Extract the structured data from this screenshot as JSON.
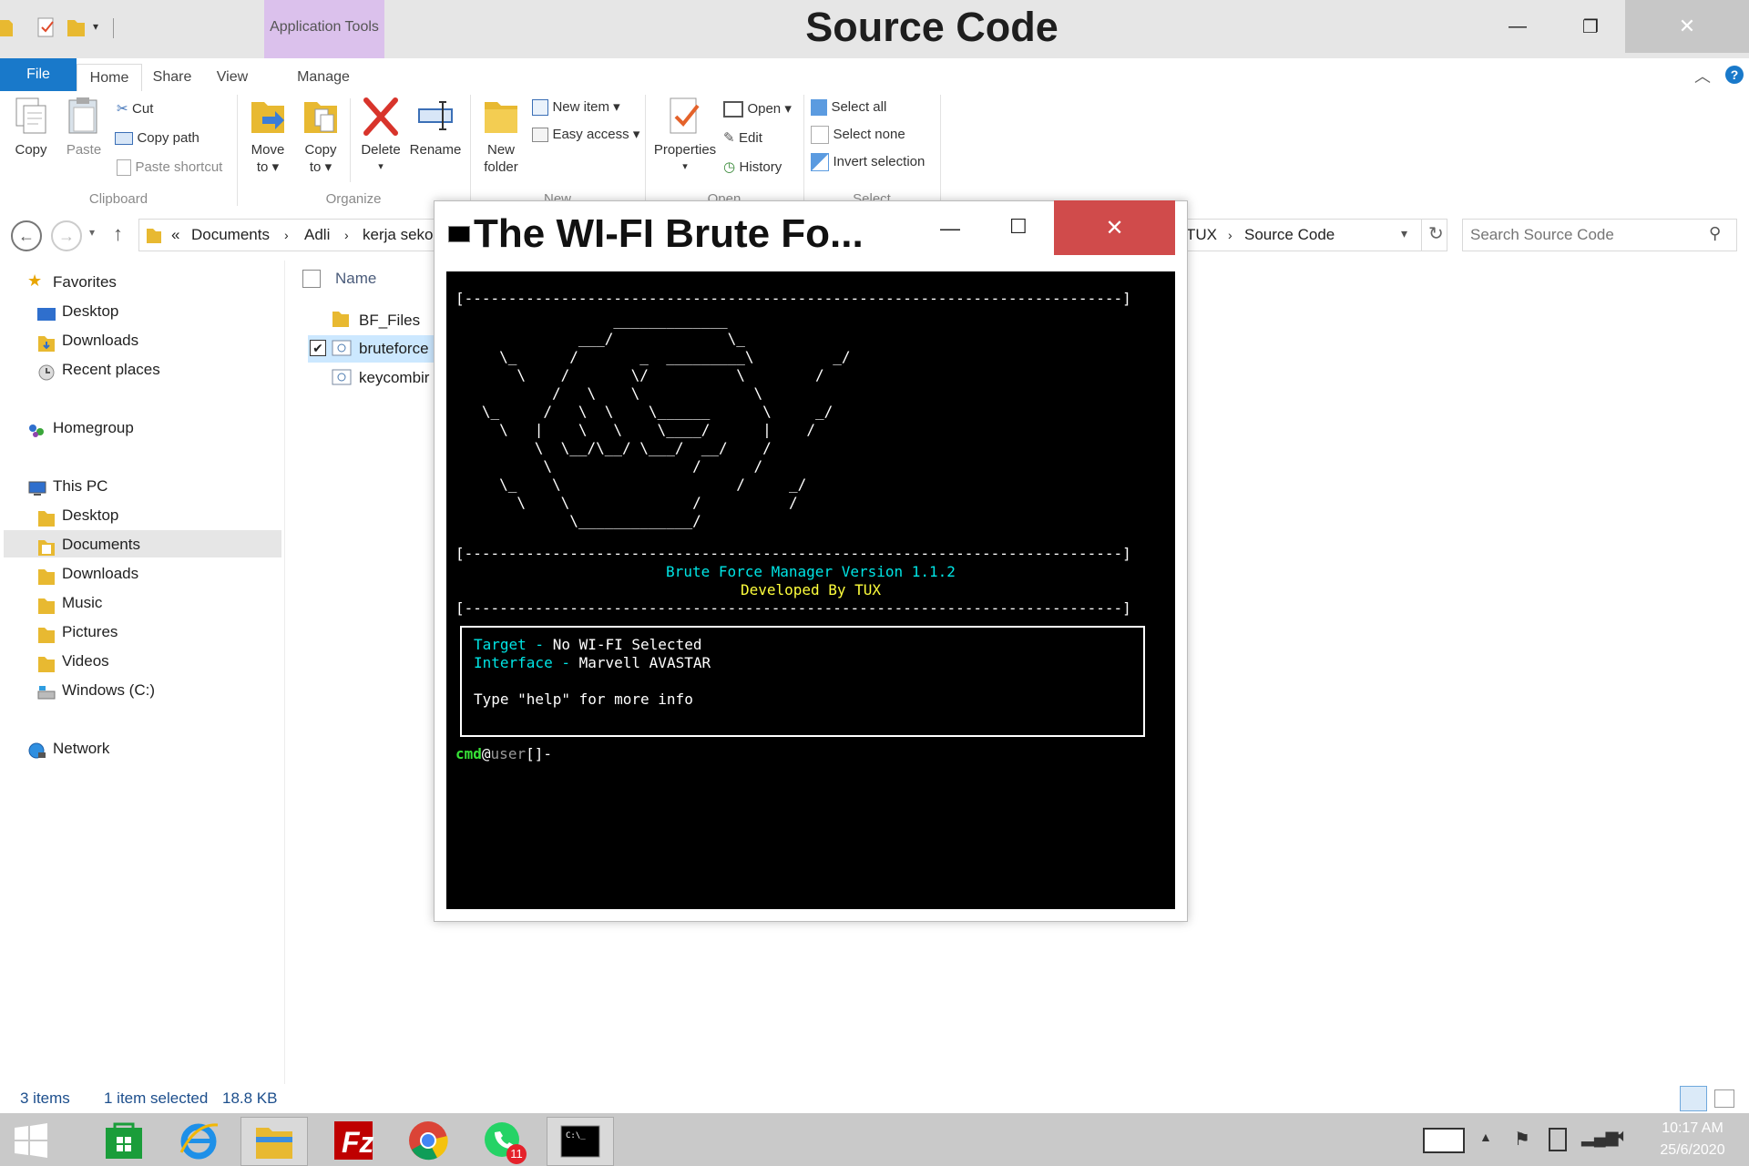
{
  "window": {
    "title": "Source Code",
    "context_tab": "Application Tools",
    "minimize_glyph": "—",
    "maximize_glyph": "❐",
    "close_glyph": "✕"
  },
  "ribbon_tabs": [
    "File",
    "Home",
    "Share",
    "View",
    "Manage"
  ],
  "ribbon": {
    "clipboard": {
      "copy": "Copy",
      "paste": "Paste",
      "cut": "Cut",
      "copy_path": "Copy path",
      "paste_shortcut": "Paste shortcut",
      "group": "Clipboard"
    },
    "organize": {
      "move_to": "Move",
      "move_to2": "to ▾",
      "copy_to": "Copy",
      "copy_to2": "to ▾",
      "delete": "Delete",
      "delete2": "▾",
      "rename": "Rename",
      "group": "Organize"
    },
    "new": {
      "new_folder": "New",
      "new_folder2": "folder",
      "new_item": "New item ▾",
      "easy_access": "Easy access ▾",
      "group": "New"
    },
    "open": {
      "properties": "Properties",
      "properties2": "▾",
      "open": "Open ▾",
      "edit": "Edit",
      "history": "History",
      "group": "Open"
    },
    "select": {
      "select_all": "Select all",
      "select_none": "Select none",
      "invert": "Invert selection",
      "group": "Select"
    }
  },
  "address": {
    "overflow": "«",
    "crumbs": [
      "Documents",
      "Adli",
      "kerja seko"
    ],
    "tail": [
      "TUX",
      "Source Code"
    ],
    "search_placeholder": "Search Source Code"
  },
  "nav": {
    "favorites": "Favorites",
    "fav_items": [
      "Desktop",
      "Downloads",
      "Recent places"
    ],
    "homegroup": "Homegroup",
    "this_pc": "This PC",
    "pc_items": [
      "Desktop",
      "Documents",
      "Downloads",
      "Music",
      "Pictures",
      "Videos",
      "Windows (C:)"
    ],
    "network": "Network"
  },
  "files": {
    "column_name": "Name",
    "rows": [
      "BF_Files",
      "bruteforce",
      "keycombir"
    ]
  },
  "status": {
    "items": "3 items",
    "selected": "1 item selected",
    "size": "18.8 KB"
  },
  "console": {
    "title": "The WI-FI Brute Fo...",
    "minimize_glyph": "—",
    "maximize_glyph": "☐",
    "close_glyph": "✕",
    "rule": "[---------------------------------------------------------------------------]",
    "art": "                  _____________\n              ___/             \\_\n     \\_      /       _  _________\\         _/\n       \\    /       \\/          \\        /\n           /   \\    \\             \\\n   \\_     /   \\  \\    \\______      \\     _/\n     \\   |    \\   \\    \\____/      |    /\n         \\  \\__/\\__/ \\___/  __/    /\n          \\                /      /\n     \\_    \\                    /     _/\n       \\    \\              /          /\n             \\_____________/",
    "banner_line1": "Brute Force Manager Version 1.1.2",
    "banner_line2": "Developed By TUX",
    "target_label": "Target -",
    "target_value": "No WI-FI Selected",
    "interface_label": "Interface -",
    "interface_value": "Marvell AVASTAR",
    "help_text": "Type \"help\" for more info",
    "prompt_cmd": "cmd",
    "prompt_at": "@",
    "prompt_user": "user",
    "prompt_rest": "[]-"
  },
  "taskbar": {
    "whatsapp_badge": "11",
    "time": "10:17 AM",
    "date": "25/6/2020"
  },
  "colors": {
    "file_tab": "#1979ca",
    "context_tab": "#dbc1ec",
    "console_close": "#d04b4b",
    "console_cyan": "#00e5e5",
    "console_yellow": "#ffff3c",
    "console_green": "#37e337"
  }
}
